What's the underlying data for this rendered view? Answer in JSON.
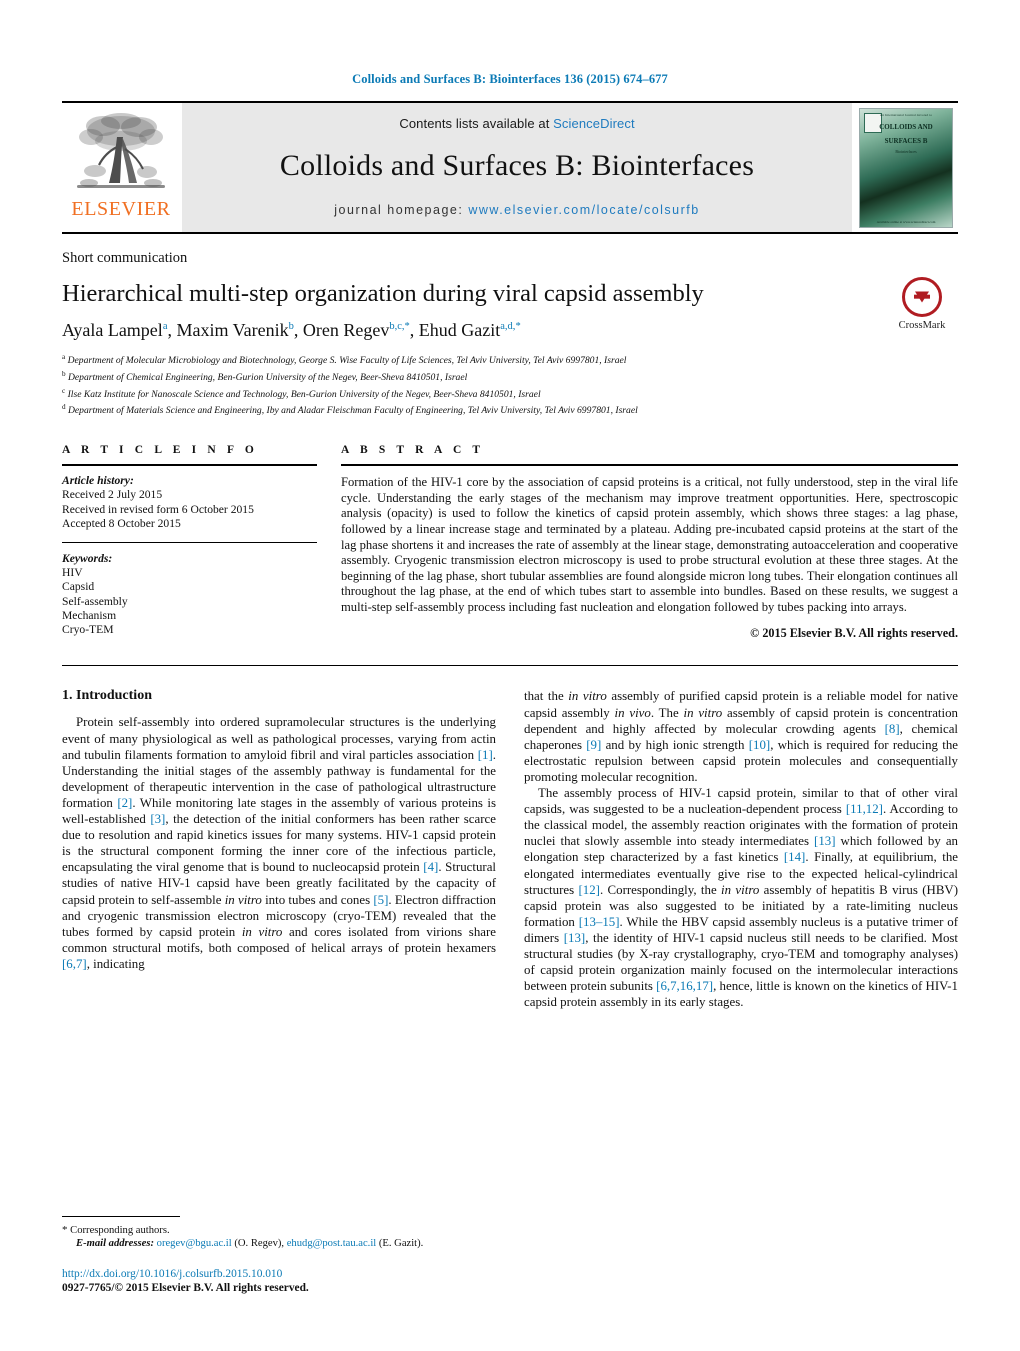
{
  "running_head": "Colloids and Surfaces B: Biointerfaces 136 (2015) 674–677",
  "masthead": {
    "contents_prefix": "Contents lists available at ",
    "sciencedirect": "ScienceDirect",
    "journal_title": "Colloids and Surfaces B: Biointerfaces",
    "homepage_label": "journal homepage:",
    "homepage_url": "www.elsevier.com/locate/colsurfb",
    "publisher_logo_text": "ELSEVIER",
    "publisher_logo_icon": "elsevier-tree-icon",
    "cover": {
      "top_line": "An International Journal    devoted to",
      "title_line1": "COLLOIDS AND",
      "title_line2": "SURFACES B",
      "subtitle": "Biointerfaces",
      "bottom_line": "Available online at www.sciencedirect.com"
    }
  },
  "article": {
    "type": "Short communication",
    "title": "Hierarchical multi-step organization during viral capsid assembly",
    "crossmark_label": "CrossMark",
    "authors": [
      {
        "name": "Ayala Lampel",
        "marks": "a",
        "sep": ", "
      },
      {
        "name": "Maxim Varenik",
        "marks": "b",
        "sep": ", "
      },
      {
        "name": "Oren Regev",
        "marks": "b,c,",
        "star": "*",
        "sep": ", "
      },
      {
        "name": "Ehud Gazit",
        "marks": "a,d,",
        "star": "*",
        "sep": ""
      }
    ],
    "affiliations": [
      {
        "mark": "a",
        "text": "Department of Molecular Microbiology and Biotechnology, George S. Wise Faculty of Life Sciences, Tel Aviv University, Tel Aviv 6997801, Israel"
      },
      {
        "mark": "b",
        "text": "Department of Chemical Engineering, Ben-Gurion University of the Negev, Beer-Sheva 8410501, Israel"
      },
      {
        "mark": "c",
        "text": "Ilse Katz Institute for Nanoscale Science and Technology, Ben-Gurion University of the Negev, Beer-Sheva 8410501, Israel"
      },
      {
        "mark": "d",
        "text": "Department of Materials Science and Engineering, Iby and Aladar Fleischman Faculty of Engineering, Tel Aviv University, Tel Aviv 6997801, Israel"
      }
    ]
  },
  "article_info": {
    "heading": "A R T I C L E   I N F O",
    "history_label": "Article history:",
    "history": [
      "Received 2 July 2015",
      "Received in revised form 6 October 2015",
      "Accepted 8 October 2015"
    ],
    "keywords_label": "Keywords:",
    "keywords": [
      "HIV",
      "Capsid",
      "Self-assembly",
      "Mechanism",
      "Cryo-TEM"
    ]
  },
  "abstract": {
    "heading": "A B S T R A C T",
    "text": "Formation of the HIV-1 core by the association of capsid proteins is a critical, not fully understood, step in the viral life cycle. Understanding the early stages of the mechanism may improve treatment opportunities. Here, spectroscopic analysis (opacity) is used to follow the kinetics of capsid protein assembly, which shows three stages: a lag phase, followed by a linear increase stage and terminated by a plateau. Adding pre-incubated capsid proteins at the start of the lag phase shortens it and increases the rate of assembly at the linear stage, demonstrating autoacceleration and cooperative assembly. Cryogenic transmission electron microscopy is used to probe structural evolution at these three stages. At the beginning of the lag phase, short tubular assemblies are found alongside micron long tubes. Their elongation continues all throughout the lag phase, at the end of which tubes start to assemble into bundles. Based on these results, we suggest a multi-step self-assembly process including fast nucleation and elongation followed by tubes packing into arrays.",
    "copyright": "© 2015 Elsevier B.V. All rights reserved."
  },
  "body": {
    "section_number_title": "1.  Introduction",
    "left_paragraphs": [
      "Protein self-assembly into ordered supramolecular structures is the underlying event of many physiological as well as pathological processes, varying from actin and tubulin filaments formation to amyloid fibril and viral particles association [1]. Understanding the initial stages of the assembly pathway is fundamental for the development of therapeutic intervention in the case of pathological ultrastructure formation [2]. While monitoring late stages in the assembly of various proteins is well-established [3], the detection of the initial conformers has been rather scarce due to resolution and rapid kinetics issues for many systems. HIV-1 capsid protein is the structural component forming the inner core of the infectious particle, encapsulating the viral genome that is bound to nucleocapsid protein [4]. Structural studies of native HIV-1 capsid have been greatly facilitated by the capacity of capsid protein to self-assemble in vitro into tubes and cones [5]. Electron diffraction and cryogenic transmission electron microscopy (cryo-TEM) revealed that the tubes formed by capsid protein in vitro and cores isolated from virions share common structural motifs, both composed of helical arrays of protein hexamers [6,7], indicating"
    ],
    "right_paragraphs": [
      "that the in vitro assembly of purified capsid protein is a reliable model for native capsid assembly in vivo. The in vitro assembly of capsid protein is concentration dependent and highly affected by molecular crowding agents [8], chemical chaperones [9] and by high ionic strength [10], which is required for reducing the electrostatic repulsion between capsid protein molecules and consequentially promoting molecular recognition.",
      "The assembly process of HIV-1 capsid protein, similar to that of other viral capsids, was suggested to be a nucleation-dependent process [11,12]. According to the classical model, the assembly reaction originates with the formation of protein nuclei that slowly assemble into steady intermediates [13] which followed by an elongation step characterized by a fast kinetics [14]. Finally, at equilibrium, the elongated intermediates eventually give rise to the expected helical-cylindrical structures [12]. Correspondingly, the in vitro assembly of hepatitis B virus (HBV) capsid protein was also suggested to be initiated by a rate-limiting nucleus formation [13–15]. While the HBV capsid assembly nucleus is a putative trimer of dimers [13], the identity of HIV-1 capsid nucleus still needs to be clarified. Most structural studies (by X-ray crystallography, cryo-TEM and tomography analyses) of capsid protein organization mainly focused on the intermolecular interactions between protein subunits [6,7,16,17], hence, little is known on the kinetics of HIV-1 capsid protein assembly in its early stages."
    ]
  },
  "footnotes": {
    "corresponding": "Corresponding authors.",
    "email_label": "E-mail addresses:",
    "email1": "oregev@bgu.ac.il",
    "email1_owner": "(O. Regev),",
    "email2": "ehudg@post.tau.ac.il",
    "email2_owner": "(E. Gazit).",
    "doi": "http://dx.doi.org/10.1016/j.colsurfb.2015.10.010",
    "issn": "0927-7765/© 2015 Elsevier B.V. All rights reserved."
  },
  "colors": {
    "link_blue": "#0b7ab5",
    "elsevier_orange": "#f06f22",
    "crossmark_red": "#b01c22"
  }
}
